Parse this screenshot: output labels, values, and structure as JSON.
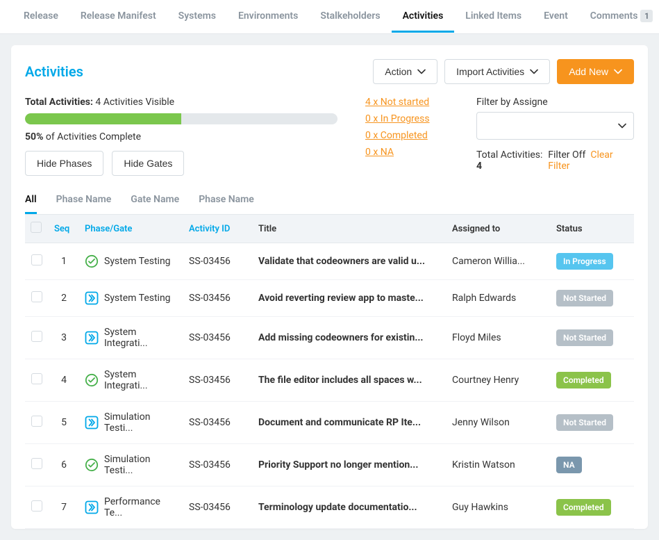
{
  "topnav": {
    "items": [
      {
        "label": "Release"
      },
      {
        "label": "Release Manifest"
      },
      {
        "label": "Systems"
      },
      {
        "label": "Environments"
      },
      {
        "label": "Stalkeholders"
      },
      {
        "label": "Activities",
        "active": true
      },
      {
        "label": "Linked Items"
      },
      {
        "label": "Event"
      },
      {
        "label": "Comments",
        "badge": "1"
      }
    ]
  },
  "panel": {
    "title": "Activities",
    "actions": {
      "action_label": "Action",
      "import_label": "Import Activities",
      "add_new_label": "Add New"
    }
  },
  "summary": {
    "total_label": "Total Activities:",
    "total_value": "4 Activities Visible",
    "progress_pct": 50,
    "complete_line_pct": "50%",
    "complete_line_rest": " of Activities Complete",
    "hide_phases": "Hide Phases",
    "hide_gates": "Hide Gates",
    "links": [
      "4 x Not started",
      "0 x In Progress",
      "0 x Completed",
      "0 x NA"
    ],
    "filter": {
      "label": "Filter by Assigne",
      "total_line": "Total Activities: ",
      "total_val": "4",
      "filter_off": "Filter Off",
      "clear": "Clear Filter"
    }
  },
  "subtabs": [
    {
      "label": "All",
      "active": true
    },
    {
      "label": "Phase Name"
    },
    {
      "label": "Gate Name"
    },
    {
      "label": "Phase Name"
    }
  ],
  "table": {
    "headers": {
      "seq": "Seq",
      "phase": "Phase/Gate",
      "activity_id": "Activity ID",
      "title": "Title",
      "assigned": "Assigned to",
      "status": "Status"
    },
    "rows": [
      {
        "seq": "1",
        "icon": "check",
        "phase": "System Testing",
        "id": "SS-03456",
        "title": "Validate that codeowners are valid u...",
        "assigned": "Cameron Willia...",
        "status": "In Progress",
        "status_class": "in-progress"
      },
      {
        "seq": "2",
        "icon": "arrow",
        "phase": "System Testing",
        "id": "SS-03456",
        "title": "Avoid reverting review app to maste...",
        "assigned": "Ralph Edwards",
        "status": "Not Started",
        "status_class": "not-started"
      },
      {
        "seq": "3",
        "icon": "arrow",
        "phase": "System Integrati...",
        "id": "SS-03456",
        "title": "Add missing codeowners for existin...",
        "assigned": "Floyd Miles",
        "status": "Not Started",
        "status_class": "not-started"
      },
      {
        "seq": "4",
        "icon": "check",
        "phase": "System Integrati...",
        "id": "SS-03456",
        "title": "The file editor includes all spaces w...",
        "assigned": "Courtney Henry",
        "status": "Completed",
        "status_class": "completed"
      },
      {
        "seq": "5",
        "icon": "arrow",
        "phase": "Simulation Testi...",
        "id": "SS-03456",
        "title": "Document and communicate RP Ite...",
        "assigned": "Jenny Wilson",
        "status": "Not Started",
        "status_class": "not-started"
      },
      {
        "seq": "6",
        "icon": "check",
        "phase": "Simulation Testi...",
        "id": "SS-03456",
        "title": "Priority Support no longer mention...",
        "assigned": "Kristin Watson",
        "status": "NA",
        "status_class": "na"
      },
      {
        "seq": "7",
        "icon": "arrow",
        "phase": "Performance Te...",
        "id": "SS-03456",
        "title": "Terminology update documentatio...",
        "assigned": "Guy Hawkins",
        "status": "Completed",
        "status_class": "completed"
      }
    ]
  }
}
